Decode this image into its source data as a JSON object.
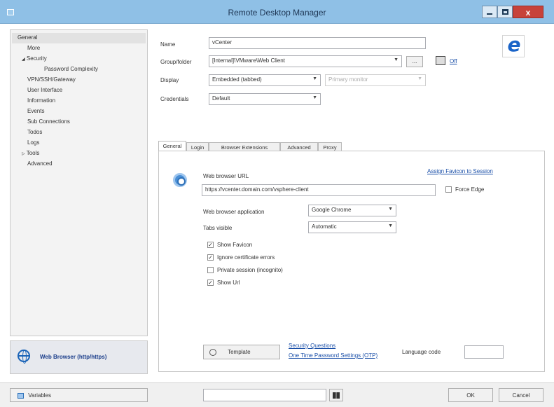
{
  "window": {
    "title": "Remote Desktop Manager"
  },
  "sidebar": {
    "items": [
      {
        "label": "General",
        "indent": 0
      },
      {
        "label": "More",
        "indent": 0
      },
      {
        "label": "Security",
        "indent": 0,
        "expanded": true
      },
      {
        "label": "Password Complexity",
        "indent": 2
      },
      {
        "label": "VPN/SSH/Gateway",
        "indent": 0
      },
      {
        "label": "User Interface",
        "indent": 0
      },
      {
        "label": "Information",
        "indent": 0
      },
      {
        "label": "Events",
        "indent": 0
      },
      {
        "label": "Sub Connections",
        "indent": 0
      },
      {
        "label": "Todos",
        "indent": 0
      },
      {
        "label": "Logs",
        "indent": 0
      },
      {
        "label": "Tools",
        "indent": 0,
        "collapsed": true
      },
      {
        "label": "Advanced",
        "indent": 0
      }
    ],
    "expand_arrow": "◢",
    "collapse_arrow": "▷",
    "entry_type_label": "Web Browser (http/https)"
  },
  "form": {
    "name_label": "Name",
    "name_value": "vCenter",
    "group_label": "Group/folder",
    "group_value": "[Internal]\\VMware\\Web Client",
    "group_browse": "...",
    "off_label": "Off",
    "display_label": "Display",
    "display_value": "Embedded (tabbed)",
    "monitor_value": "Primary monitor",
    "credentials_label": "Credentials",
    "credentials_value": "Default"
  },
  "tabs": [
    "General",
    "Login",
    "Browser Extensions",
    "Advanced",
    "Proxy"
  ],
  "general": {
    "url_label": "Web browser URL",
    "assign_favicon": "Assign Favicon to Session",
    "url_value": "https://vcenter.domain.com/vsphere-client",
    "force_edge": "Force Edge",
    "app_label": "Web browser application",
    "app_value": "Google Chrome",
    "tabs_visible_label": "Tabs visible",
    "tabs_visible_value": "Automatic",
    "options": [
      {
        "label": "Show Favicon",
        "checked": true
      },
      {
        "label": "Ignore certificate errors",
        "checked": true
      },
      {
        "label": "Private session (incognito)",
        "checked": false
      },
      {
        "label": "Show Url",
        "checked": true
      }
    ],
    "check_mark": "✓"
  },
  "footer": {
    "template_label": "Template",
    "security_questions": "Security Questions",
    "otp_settings": "One Time Password Settings (OTP)",
    "language_label": "Language code",
    "language_value": ""
  },
  "bottombar": {
    "variables_label": "Variables",
    "search_value": "",
    "ok_label": "OK",
    "cancel_label": "Cancel"
  },
  "colors": {
    "titlebar": "#8fc0e6",
    "close_button": "#c7423a",
    "link": "#1a4fa8",
    "selection": "#e2e2e2"
  },
  "icons": {
    "app": "window-icon",
    "minimize": "minimize-icon",
    "maximize": "maximize-icon",
    "close": "close-icon",
    "entry_type": "globe-icon",
    "ie": "internet-explorer-icon",
    "chrome": "chrome-icon",
    "template": "template-icon",
    "binoculars": "binoculars-icon",
    "variables": "variables-icon",
    "off": "screen-icon"
  }
}
